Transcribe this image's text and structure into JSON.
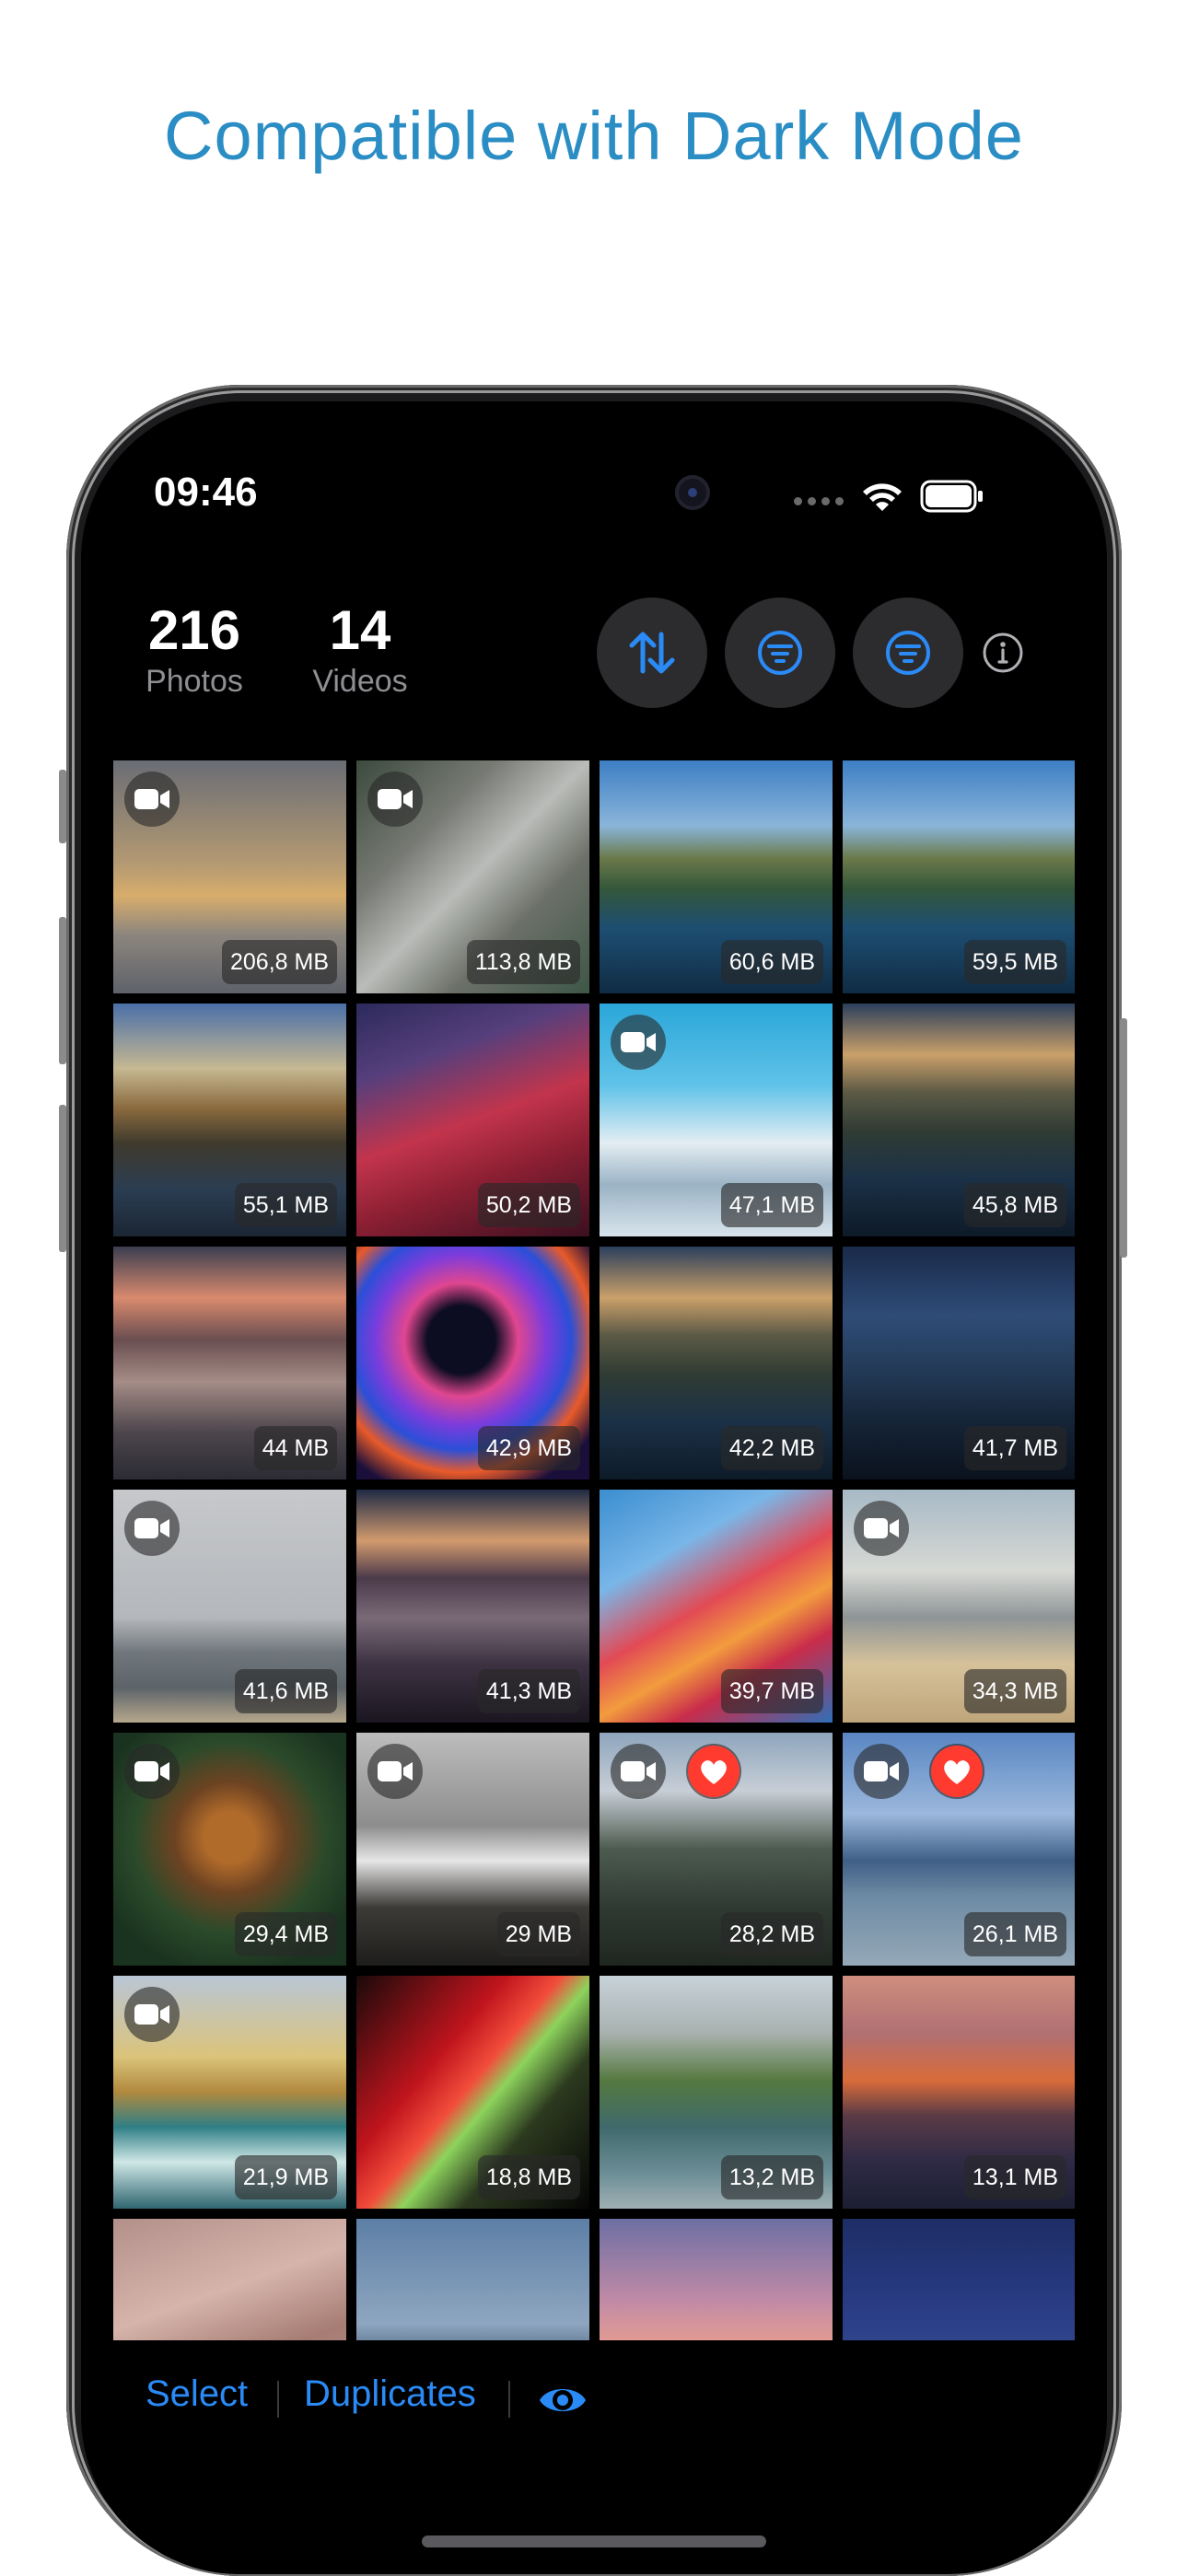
{
  "headline": "Compatible with Dark Mode",
  "status_bar": {
    "time": "09:46"
  },
  "stats": {
    "photos": {
      "count": "216",
      "label": "Photos"
    },
    "videos": {
      "count": "14",
      "label": "Videos"
    }
  },
  "toolbar": {
    "sort_icon": "sort-arrows-icon",
    "filter_icon": "filter-icon",
    "info_icon": "info-icon",
    "accent": "#2a8bf7"
  },
  "grid": {
    "tiles": [
      {
        "size": "206,8 MB",
        "video": true,
        "favorite": false,
        "theme": "foggy-sunrise"
      },
      {
        "size": "113,8 MB",
        "video": true,
        "favorite": false,
        "theme": "city-aerial"
      },
      {
        "size": "60,6 MB",
        "video": false,
        "favorite": false,
        "theme": "coast-day"
      },
      {
        "size": "59,5 MB",
        "video": false,
        "favorite": false,
        "theme": "coast-day"
      },
      {
        "size": "55,1 MB",
        "video": false,
        "favorite": false,
        "theme": "coast-sunset"
      },
      {
        "size": "50,2 MB",
        "video": false,
        "favorite": false,
        "theme": "big-sur-red"
      },
      {
        "size": "47,1 MB",
        "video": true,
        "favorite": false,
        "theme": "snow-mountains"
      },
      {
        "size": "45,8 MB",
        "video": false,
        "favorite": false,
        "theme": "coast-dusk"
      },
      {
        "size": "44 MB",
        "video": false,
        "favorite": false,
        "theme": "fog-pink"
      },
      {
        "size": "42,9 MB",
        "video": false,
        "favorite": false,
        "theme": "abstract-swirl"
      },
      {
        "size": "42,2 MB",
        "video": false,
        "favorite": false,
        "theme": "coast-dusk"
      },
      {
        "size": "41,7 MB",
        "video": false,
        "favorite": false,
        "theme": "coast-night"
      },
      {
        "size": "41,6 MB",
        "video": true,
        "favorite": false,
        "theme": "grey-sea"
      },
      {
        "size": "41,3 MB",
        "video": false,
        "favorite": false,
        "theme": "fog-night"
      },
      {
        "size": "39,7 MB",
        "video": false,
        "favorite": false,
        "theme": "big-sur-light"
      },
      {
        "size": "34,3 MB",
        "video": true,
        "favorite": false,
        "theme": "beach-city"
      },
      {
        "size": "29,4 MB",
        "video": true,
        "favorite": false,
        "theme": "butterfly"
      },
      {
        "size": "29 MB",
        "video": true,
        "favorite": false,
        "theme": "waterfall"
      },
      {
        "size": "28,2 MB",
        "video": true,
        "favorite": true,
        "theme": "mountains-grey"
      },
      {
        "size": "26,1 MB",
        "video": true,
        "favorite": true,
        "theme": "city-river"
      },
      {
        "size": "21,9 MB",
        "video": true,
        "favorite": false,
        "theme": "cliffs"
      },
      {
        "size": "18,8 MB",
        "video": false,
        "favorite": false,
        "theme": "green-red-beam"
      },
      {
        "size": "13,2 MB",
        "video": false,
        "favorite": false,
        "theme": "coast-green"
      },
      {
        "size": "13,1 MB",
        "video": false,
        "favorite": false,
        "theme": "sierra"
      },
      {
        "size": "",
        "video": false,
        "favorite": false,
        "theme": "rock-pink"
      },
      {
        "size": "",
        "video": false,
        "favorite": false,
        "theme": "sea-rocks"
      },
      {
        "size": "",
        "video": false,
        "favorite": false,
        "theme": "pink-sky"
      },
      {
        "size": "",
        "video": false,
        "favorite": false,
        "theme": "blue-night"
      }
    ]
  },
  "bottom_bar": {
    "select_label": "Select",
    "duplicates_label": "Duplicates",
    "eye_icon": "eye-icon"
  }
}
